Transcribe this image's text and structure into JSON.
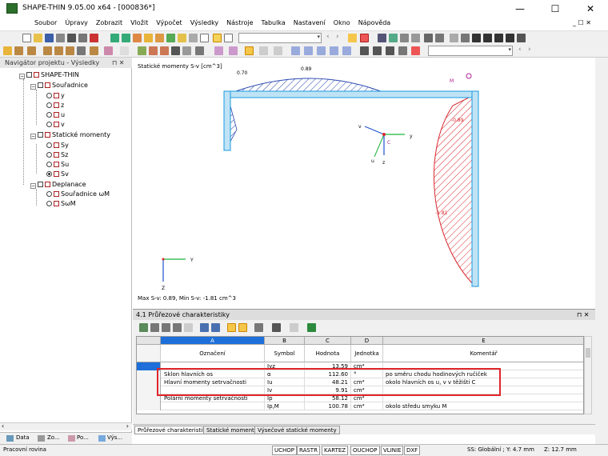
{
  "window": {
    "title": "SHAPE-THIN 9.05.00 x64 - [000836*]",
    "minimize": "—",
    "maximize": "☐",
    "close": "✕"
  },
  "menu": [
    "Soubor",
    "Úpravy",
    "Zobrazit",
    "Vložit",
    "Výpočet",
    "Výsledky",
    "Nástroje",
    "Tabulka",
    "Nastavení",
    "Okno",
    "Nápověda"
  ],
  "menu_right": {
    "restore": "_ ☐ ✕"
  },
  "navigator": {
    "title": "Navigátor projektu - Výsledky",
    "pin": "⊓ ✕",
    "root": "SHAPE-THIN",
    "groups": [
      {
        "label": "Souřadnice",
        "items": [
          "y",
          "z",
          "u",
          "v"
        ]
      },
      {
        "label": "Statické momenty",
        "items": [
          "Sy",
          "Sz",
          "Su",
          "Sv"
        ]
      },
      {
        "label": "Deplanace",
        "items": [
          "Souřadnice ωM",
          "SωM"
        ]
      }
    ],
    "tabs": [
      "Data",
      "Zo...",
      "Po...",
      "Výs..."
    ]
  },
  "view": {
    "title": "Statické momenty S-v [cm^3]",
    "footer": "Max S-v: 0.89, Min S-v: -1.81 cm^3",
    "labels": {
      "v1": "0.70",
      "v2": "0.89",
      "v3": "-0.89",
      "v4": "-1.81",
      "m": "M",
      "c": "C",
      "y": "y",
      "z": "z",
      "u": "u",
      "v": "v",
      "Y": "Y",
      "Z": "Z"
    }
  },
  "panel": {
    "title": "4.1 Průřezové charakteristiky",
    "pin": "⊓ ✕",
    "columns": [
      "A",
      "B",
      "C",
      "D",
      "E"
    ],
    "subheaders": [
      "Označení",
      "Symbol",
      "Hodnota",
      "Jednotka",
      "Komentář"
    ],
    "rows": [
      {
        "name": "",
        "symbol": "Iyz",
        "value": "13.59",
        "unit": "cm⁴",
        "comment": ""
      },
      {
        "name": "Sklon hlavních os",
        "symbol": "α",
        "value": "112.60",
        "unit": "°",
        "comment": "po směru chodu hodinových ručiček"
      },
      {
        "name": "Hlavní momenty setrvačnosti",
        "symbol": "Iu",
        "value": "48.21",
        "unit": "cm⁴",
        "comment": "okolo hlavních os u, v v těžišti C"
      },
      {
        "name": "",
        "symbol": "Iv",
        "value": "9.91",
        "unit": "cm⁴",
        "comment": ""
      },
      {
        "name": "Polární momenty setrvačnosti",
        "symbol": "Ip",
        "value": "58.12",
        "unit": "cm⁴",
        "comment": ""
      },
      {
        "name": "",
        "symbol": "Ip,M",
        "value": "100.78",
        "unit": "cm⁴",
        "comment": "okolo středu smyku M"
      }
    ],
    "tabs": [
      "Průřezové charakteristiky",
      "Statické momenty",
      "Výsečové statické momenty"
    ]
  },
  "status": {
    "left": "Pracovní rovina",
    "buttons": [
      "UCHOP",
      "RASTR",
      "KARTEZ",
      "OUCHOP",
      "VLINIE",
      "DXF"
    ],
    "coords": "SS: Globální ; Y: 4.7 mm",
    "z": "Z: 12.7 mm"
  },
  "colors": {
    "accent": "#1e6fd9",
    "highlight": "#e0252a",
    "hatch": "#d9282f",
    "profile": "#1a9adf"
  }
}
